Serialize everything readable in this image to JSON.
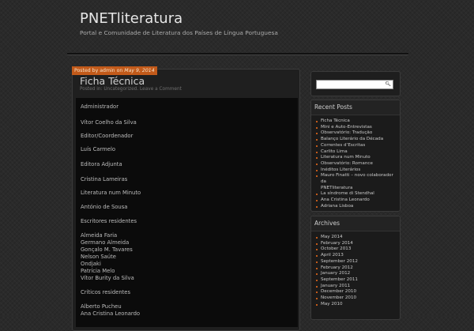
{
  "site": {
    "title": "PNETliteratura",
    "description": "Portal e Comunidade de Literatura dos Países de Língua Portuguesa"
  },
  "post": {
    "meta_prefix": "Posted by",
    "author": "admin",
    "on": "on",
    "date": "May 9, 2014",
    "title": "Ficha Técnica",
    "posted_in": "Posted in:",
    "category": "Uncategorized.",
    "comment_link": "Leave a Comment",
    "lines": [
      "Administrador",
      "Vítor Coelho da Silva",
      "Editor/Coordenador",
      "Luís Carmelo",
      "Editora Adjunta",
      "Cristina Lameiras",
      "Literatura num Minuto",
      "António de Sousa",
      "Escritores residentes",
      "Almeida Faria",
      "Germano Almeida",
      "Gonçalo M. Tavares",
      "Nelson Saúte",
      "Ondjaki",
      "Patrícia Melo",
      "Vítor Burity da Silva",
      "Críticos residentes",
      "Alberto Pucheu",
      "Ana Cristina Leonardo"
    ]
  },
  "sidebar": {
    "search_icon": "search-icon",
    "recent_title": "Recent Posts",
    "recent": [
      "Ficha Técnica",
      "Mini e Auto-Entrevistas",
      "Observatório: Tradução",
      "Balanço Literário da Década",
      "Correntes d’Escritas",
      "Carlito Lima",
      "Literatura num Minuto",
      "Observatório: Romance",
      "Inéditos Literários",
      "Mauro Finatti – novo colaborador da",
      "PNETliteratura",
      "La síndrome di Stendhal",
      "Ana Cristina Leonardo",
      "Adriana Lisboa"
    ],
    "archives_title": "Archives",
    "archives": [
      "May 2014",
      "February 2014",
      "October 2013",
      "April 2013",
      "September 2012",
      "February 2012",
      "January 2012",
      "September 2011",
      "January 2011",
      "December 2010",
      "November 2010",
      "May 2010"
    ]
  },
  "colors": {
    "accent": "#c25a1a",
    "background": "#2a2a2a"
  }
}
